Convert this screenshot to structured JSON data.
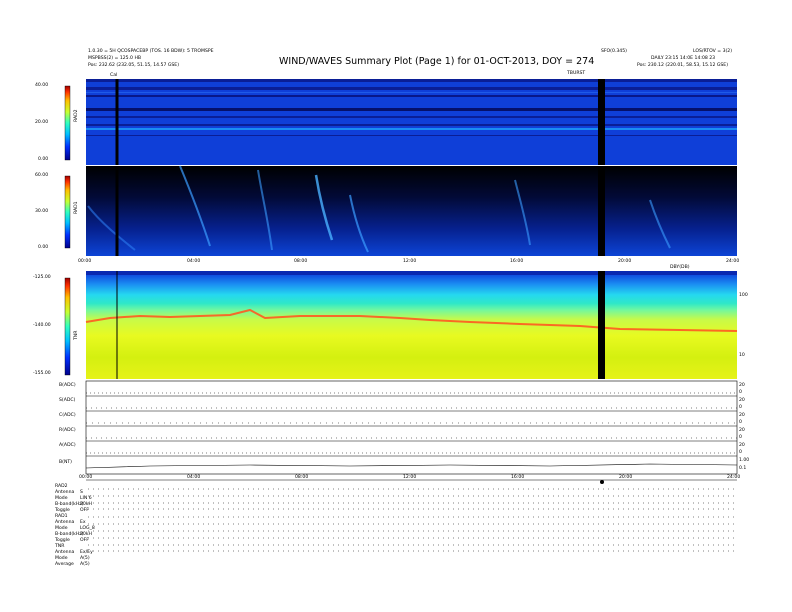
{
  "header": {
    "title": "WIND/WAVES Summary Plot (Page 1) for 01-OCT-2013, DOY = 274",
    "left_line1": "1.0.30 = 5H QCOSPACEBP (TOS. 16 BDW): 5 TROMSPE",
    "left_line2": "MSPBSS(2) = 125.0 HB",
    "left_line3": "Pos:   232.62 (232.05, 51.15, 14.57 GSE)",
    "right_line1a": "SFO(0.345)",
    "right_line1b": "LOS/RTOV = 3(2)",
    "right_line2": "DAILY  23:15  14:0E  14:08  23",
    "right_line3": "Pos:   230.12 (220.01, 58.53, 15.12 GSE)",
    "tag_left": "Cal",
    "tag_mid": "TBURST",
    "tag_right": "SH3"
  },
  "colors": {
    "background": "#ffffff",
    "blue_dark": "#0a1e96",
    "blue_bg": "#0f3fd8",
    "black": "#000000"
  },
  "panels": {
    "rad2_label": "RAD2",
    "rad1_label": "RAD1",
    "tnr_label": "TNR",
    "tnr_right_top": "100",
    "tnr_right_bottom": "10",
    "tnr_tag": "DBY(DB)"
  },
  "chart_data": {
    "type": "heatmap",
    "x_range_hours": [
      0,
      24
    ],
    "time_ticks": [
      "00:00",
      "04:00",
      "08:00",
      "12:00",
      "16:00",
      "20:00",
      "24:00"
    ],
    "rad2": {
      "ylim": [
        0,
        40
      ],
      "yticks": [
        "40.00",
        "20.00",
        "0.00"
      ],
      "ylabel": "RAD2"
    },
    "rad1": {
      "ylim": [
        0,
        60
      ],
      "yticks": [
        "60.00",
        "30.00",
        "0.00"
      ],
      "ylabel": "RAD1"
    },
    "tnr": {
      "ylim": [
        -155,
        -125
      ],
      "yticks": [
        "-125.00",
        "-140.00",
        "-155.00"
      ],
      "ylabel": "TNR"
    },
    "data_gaps_hours": [
      [
        1.25,
        1.4
      ],
      [
        19.15,
        19.38
      ]
    ],
    "colorbar": "rainbow (blue low, red high)",
    "status_rows": [
      {
        "label": "B(ADC)",
        "right": [
          "20",
          "0"
        ]
      },
      {
        "label": "S(ADC)",
        "right": [
          "20",
          "0"
        ]
      },
      {
        "label": "C(ADC)",
        "right": [
          "20",
          "0"
        ]
      },
      {
        "label": "R(ADC)",
        "right": [
          "20",
          "0"
        ]
      },
      {
        "label": "A(ADC)",
        "right": [
          "20",
          "0"
        ]
      },
      {
        "label": "B(NT)",
        "right": [
          "1.00",
          "0.1"
        ]
      }
    ]
  },
  "bottom": {
    "rad2_head": "RAD2",
    "rad2_rows": [
      {
        "k": "Antenna",
        "v": "S"
      },
      {
        "k": "Mode",
        "v": "LIN 6"
      },
      {
        "k": "B-band(kHz)",
        "v": "20kH"
      },
      {
        "k": "Toggle",
        "v": "OFF"
      }
    ],
    "rad1_head": "RAD1",
    "rad1_rows": [
      {
        "k": "Antenna",
        "v": "Ex"
      },
      {
        "k": "Mode",
        "v": "LOG_8"
      },
      {
        "k": "B-band(kHz)",
        "v": "20kH"
      },
      {
        "k": "Toggle",
        "v": "OFF"
      }
    ],
    "tnr_head": "TNR",
    "tnr_rows": [
      {
        "k": "Antenna",
        "v": "Ex/Ey"
      },
      {
        "k": "Mode",
        "v": "A(5)"
      },
      {
        "k": "Average",
        "v": "A(5)"
      }
    ]
  }
}
